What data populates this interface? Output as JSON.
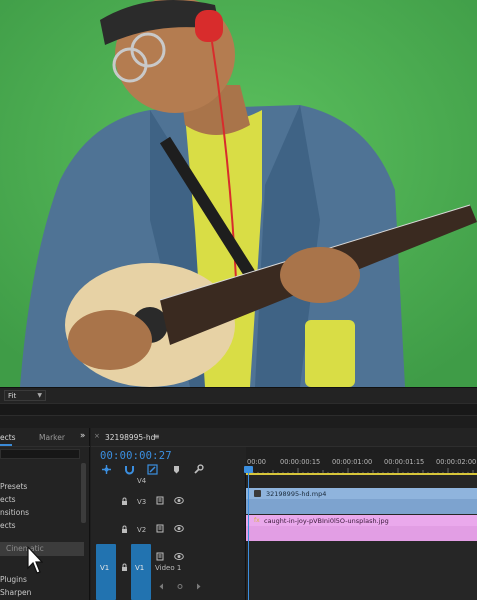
{
  "monitor": {
    "fit_label": "Fit"
  },
  "effects_panel": {
    "tab_effects": "ects",
    "tab_marker": "Marker",
    "tab_more": "»",
    "items": [
      "Presets",
      "ects",
      "nsitions",
      "ects",
      "Cinematic",
      "Plugins",
      "Sharpen"
    ],
    "selected_item": "Cinematic"
  },
  "timeline": {
    "close_glyph": "×",
    "sequence_name": "32198995-hd",
    "timecode": "00:00:00:27",
    "ruler_labels": [
      "00:00",
      "00:00:00:15",
      "00:00:01:00",
      "00:00:01:15",
      "00:00:02:00"
    ],
    "tracks": {
      "v4": "V4",
      "v3": "V3",
      "v2": "V2",
      "v1_source": "V1",
      "v1_target": "V1",
      "v1_name": "Video 1"
    },
    "clips": {
      "video": "32198995-hd.mp4",
      "image": "caught-in-joy-pVBIni0l5O-unsplash.jpg"
    }
  },
  "colors": {
    "accent_blue": "#3b8fe0",
    "video_clip": "#7da3cf",
    "image_clip": "#e29ee4",
    "green_screen": "#4fb154"
  }
}
